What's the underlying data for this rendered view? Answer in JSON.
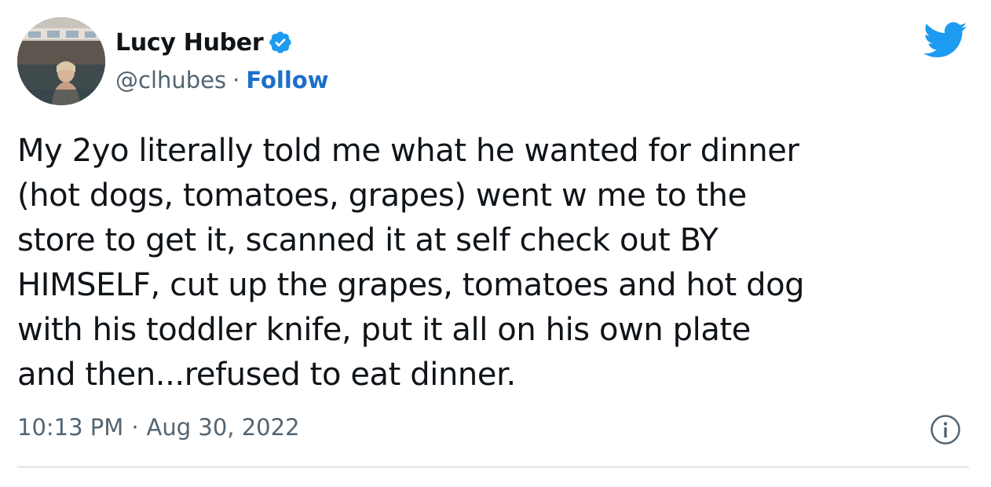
{
  "user": {
    "display_name": "Lucy Huber",
    "handle": "@clhubes",
    "separator": "·",
    "follow_label": "Follow",
    "verified": true
  },
  "tweet": {
    "text": "My 2yo literally told me what he wanted for dinner\n(hot dogs, tomatoes, grapes) went w me to the\nstore to get it, scanned it at self check out BY\nHIMSELF, cut up the grapes, tomatoes and hot dog\nwith his toddler knife, put it all on his own plate\nand then...refused to eat dinner."
  },
  "meta": {
    "time": "10:13 PM",
    "separator": "·",
    "date": "Aug 30, 2022"
  },
  "icons": {
    "verified": "verified-badge-icon",
    "brand": "twitter-bird-icon",
    "info": "info-icon"
  },
  "colors": {
    "brand_blue": "#1d9bf0",
    "link_blue": "#1d6fc9",
    "text": "#0f1419",
    "secondary_text": "#536471"
  }
}
